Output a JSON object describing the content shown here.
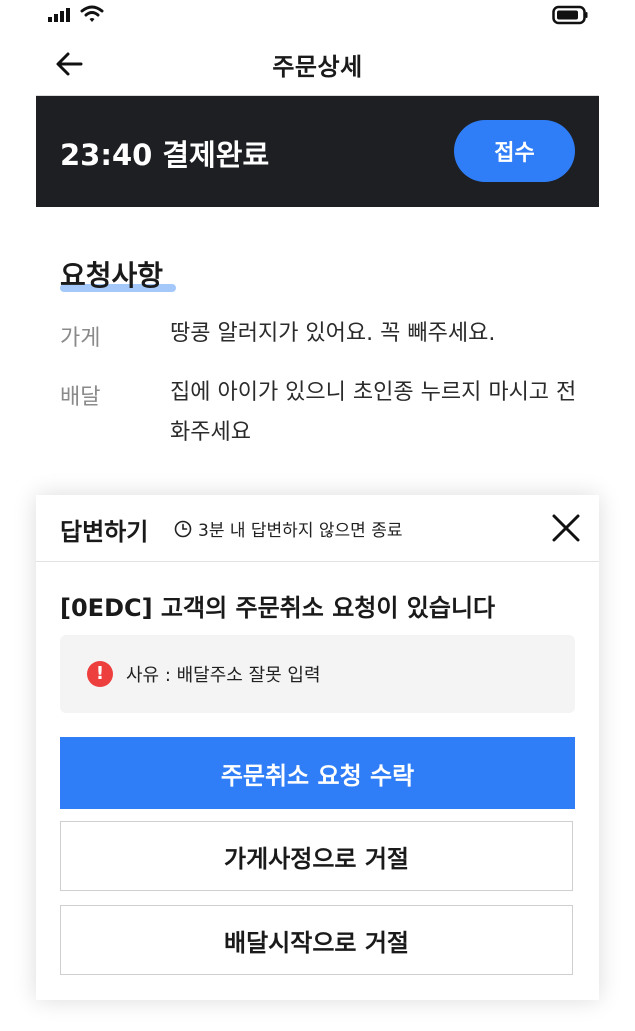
{
  "header": {
    "title": "주문상세",
    "back_icon": "arrow-left-icon"
  },
  "order_status": {
    "text": "23:40 결제완료",
    "accept_label": "접수",
    "accent": "#2f7ef7",
    "bg": "#1e1f23"
  },
  "requests": {
    "title": "요청사항",
    "items": [
      {
        "label": "가게",
        "value": "땅콩 알러지가 있어요. 꼭 빼주세요."
      },
      {
        "label": "배달",
        "value": "집에 아이가 있으니 초인종 누르지 마시고 전화주세요"
      }
    ]
  },
  "modal": {
    "title": "답변하기",
    "timer_text": "3분 내 답변하지 않으면 종료",
    "message": "[0EDC] 고객의 주문취소 요청이 있습니다",
    "reason": "사유 : 배달주소 잘못 입력",
    "alert_symbol": "!",
    "buttons": {
      "accept": "주문취소 요청 수락",
      "reject_store": "가게사정으로 거절",
      "reject_delivery": "배달시작으로 거절"
    },
    "alert_color": "#ee3f3f"
  }
}
